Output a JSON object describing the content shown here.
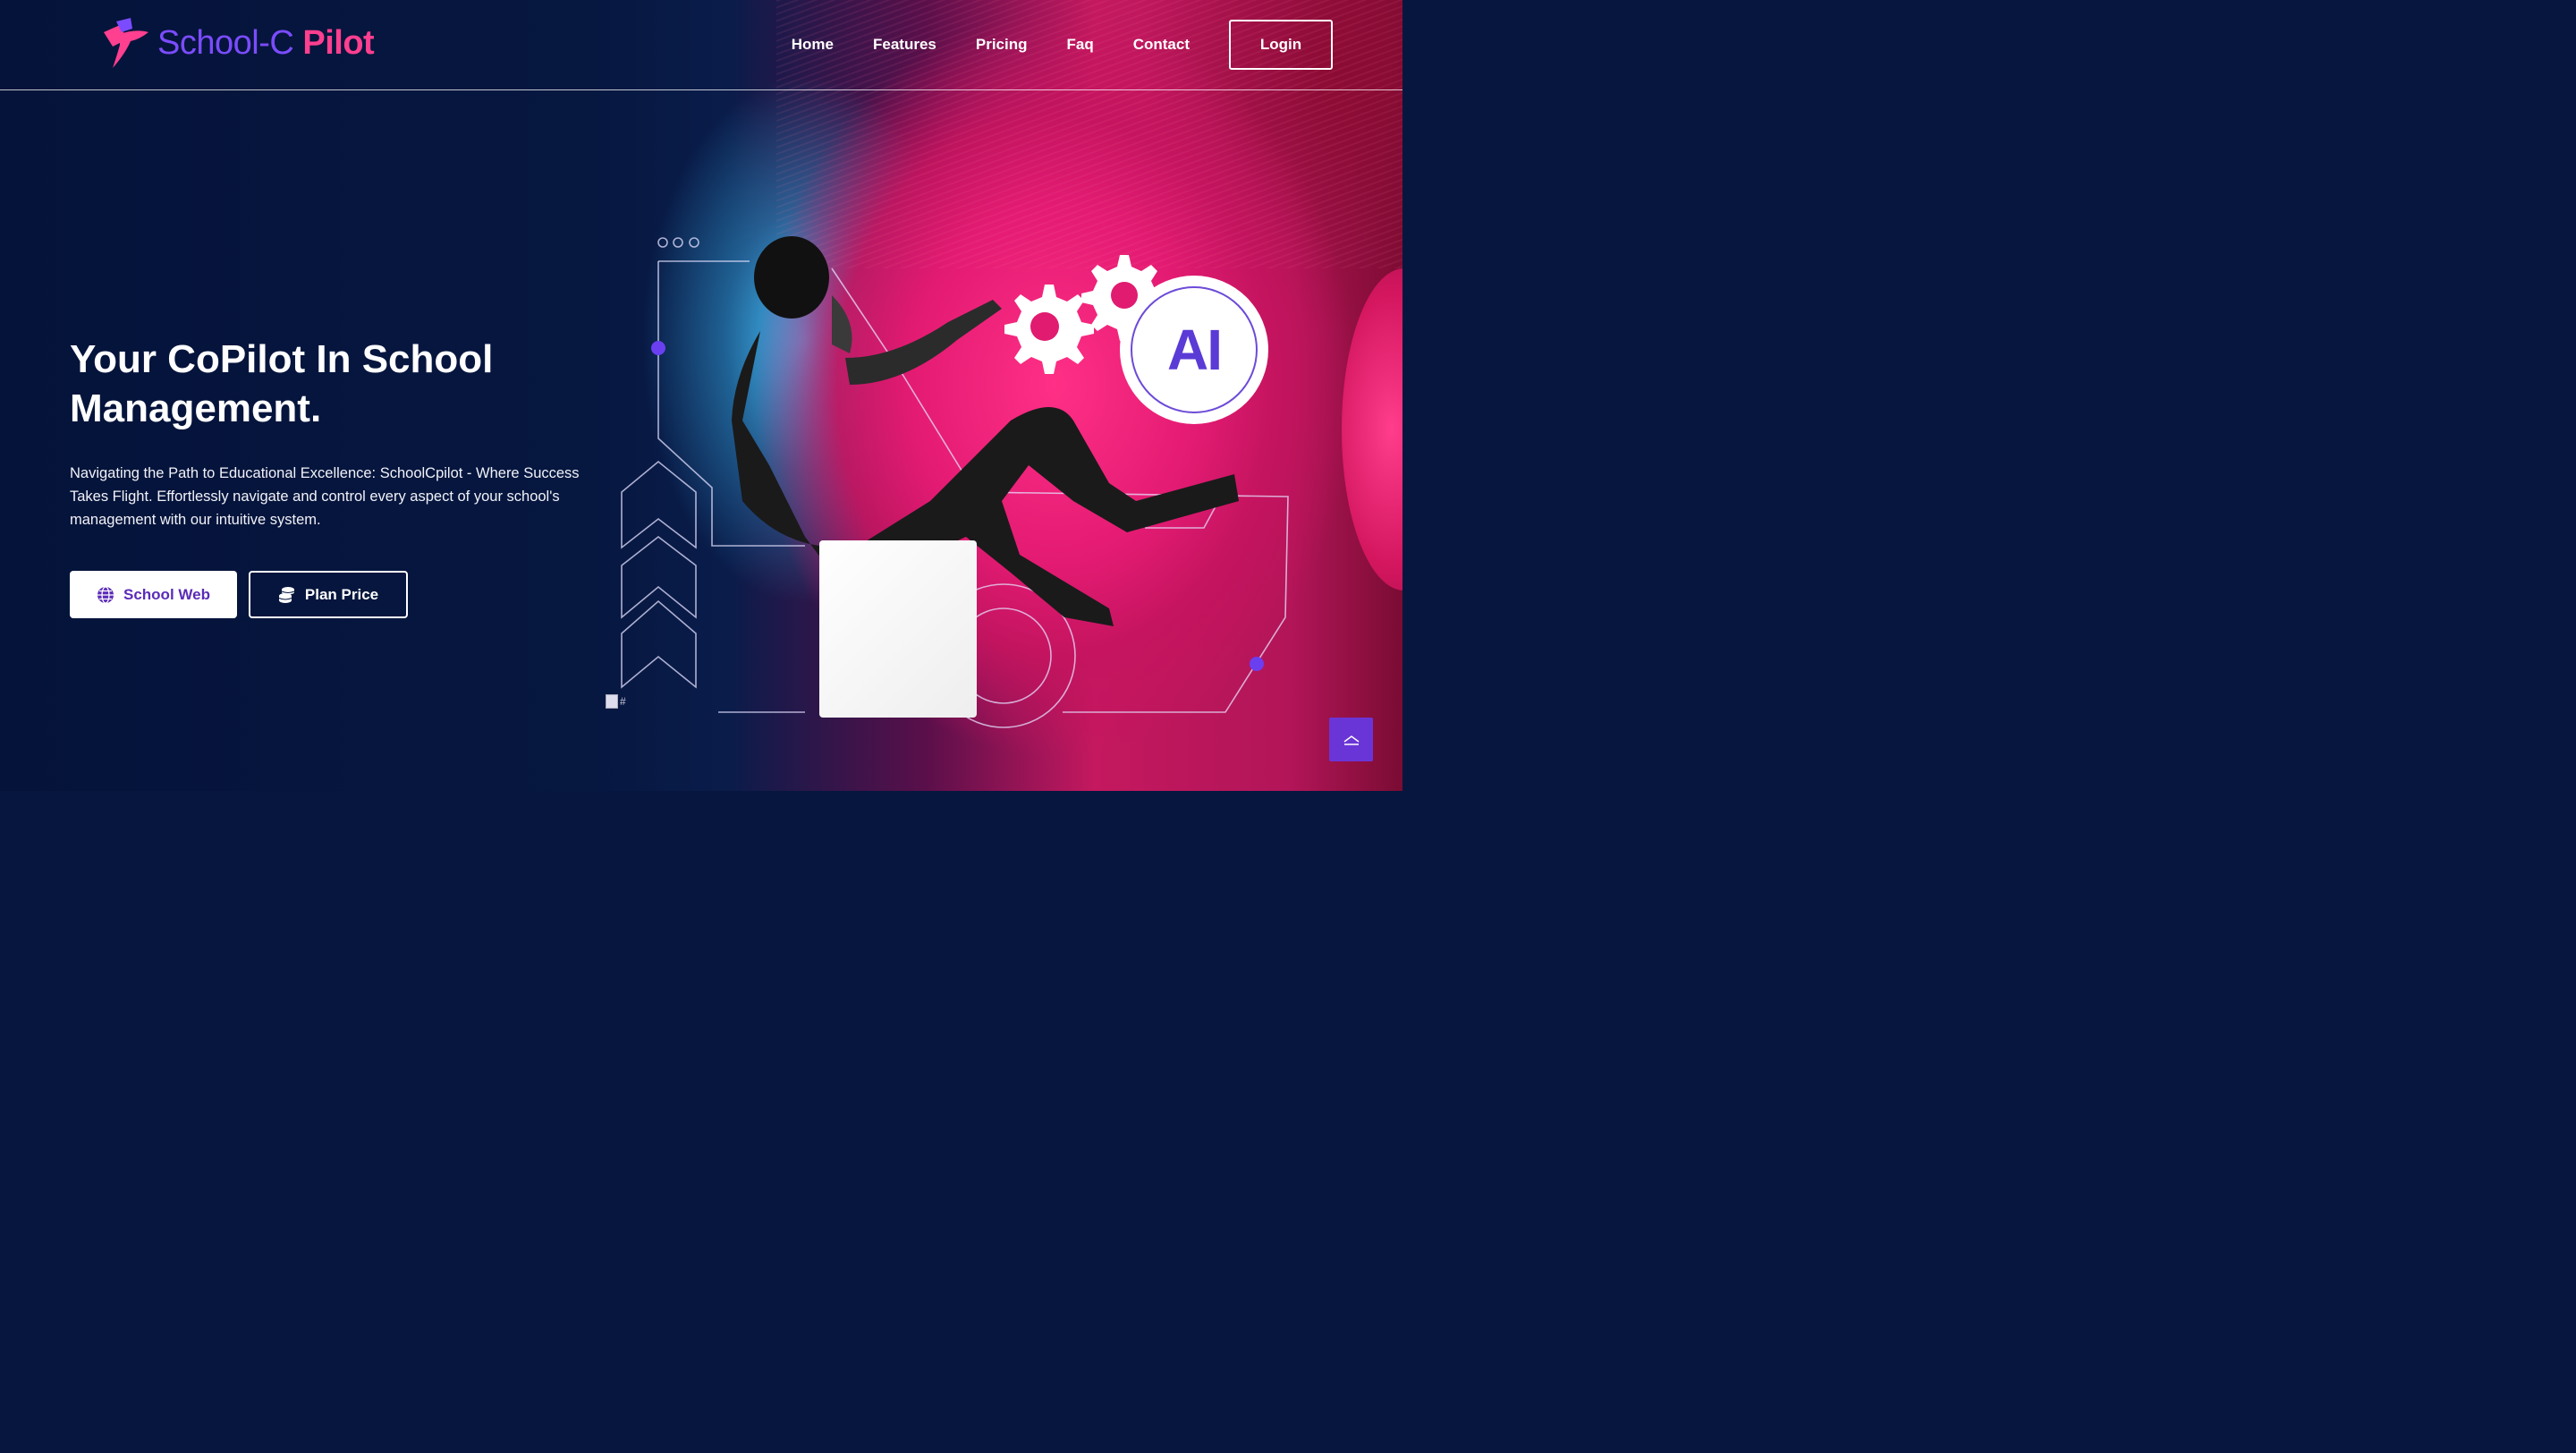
{
  "brand": {
    "name_part1": "School-C",
    "name_part2": "Pilot"
  },
  "nav": {
    "items": [
      "Home",
      "Features",
      "Pricing",
      "Faq",
      "Contact"
    ],
    "login_label": "Login"
  },
  "hero": {
    "title": "Your CoPilot In School Management.",
    "description": "Navigating the Path to Educational Excellence: SchoolCpilot - Where Success Takes Flight. Effortlessly navigate and control every aspect of your school's management with our intuitive system.",
    "primary_button": "School Web",
    "secondary_button": "Plan Price",
    "badge_text": "AI",
    "broken_image_alt": "#"
  },
  "colors": {
    "background": "#06163f",
    "accent_purple": "#6a35d6",
    "accent_pink": "#ff3f8f"
  },
  "icons": {
    "logo": "book-bird-icon",
    "primary_button": "globe-icon",
    "secondary_button": "coins-icon",
    "scroll": "chevron-up-icon"
  }
}
